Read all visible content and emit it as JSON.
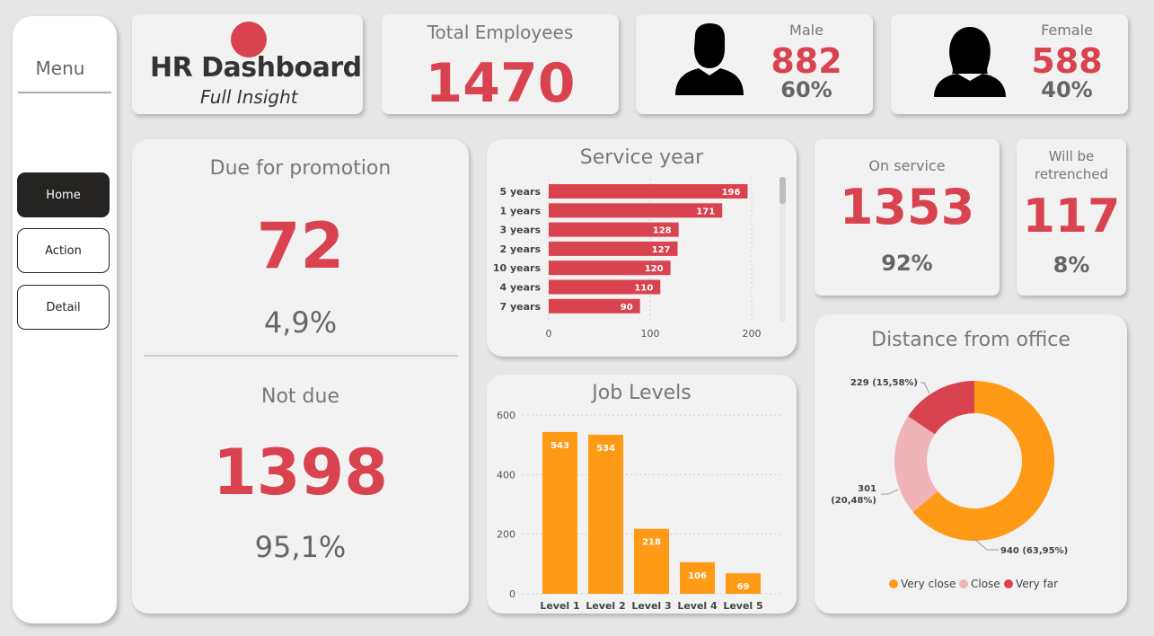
{
  "sidebar": {
    "title": "Menu",
    "buttons": [
      {
        "label": "Home",
        "active": true
      },
      {
        "label": "Action",
        "active": false
      },
      {
        "label": "Detail",
        "active": false
      }
    ]
  },
  "logo": {
    "title": "HR Dashboard",
    "subtitle": "Full Insight"
  },
  "total_employees": {
    "label": "Total Employees",
    "value": "1470"
  },
  "male": {
    "label": "Male",
    "value": "882",
    "pct": "60%",
    "icon": "male-person-icon"
  },
  "female": {
    "label": "Female",
    "value": "588",
    "pct": "40%",
    "icon": "female-person-icon"
  },
  "promotion": {
    "due_label": "Due for promotion",
    "due_value": "72",
    "due_pct": "4,9%",
    "not_due_label": "Not due",
    "not_due_value": "1398",
    "not_due_pct": "95,1%"
  },
  "on_service": {
    "label": "On service",
    "value": "1353",
    "pct": "92%"
  },
  "retrenched": {
    "label_line1": "Will be",
    "label_line2": "retrenched",
    "value": "117",
    "pct": "8%"
  },
  "colors": {
    "accent_red": "#d9434f",
    "bar_orange": "#ff9a17",
    "close_pink": "#f0b3b8"
  },
  "chart_data": [
    {
      "type": "bar",
      "orientation": "horizontal",
      "title": "Service year",
      "categories": [
        "5 years",
        "1 years",
        "3 years",
        "2 years",
        "10 years",
        "4 years",
        "7 years"
      ],
      "values": [
        196,
        171,
        128,
        127,
        120,
        110,
        90
      ],
      "xticks": [
        "0",
        "100",
        "200"
      ],
      "xlim": [
        0,
        200
      ],
      "grid": true,
      "color": "#d9434f"
    },
    {
      "type": "bar",
      "title": "Job Levels",
      "categories": [
        "Level 1",
        "Level 2",
        "Level 3",
        "Level 4",
        "Level 5"
      ],
      "values": [
        543,
        534,
        218,
        106,
        69
      ],
      "yticks": [
        "0",
        "200",
        "400",
        "600"
      ],
      "ylim": [
        0,
        600
      ],
      "grid": true,
      "color": "#ff9a17"
    },
    {
      "type": "pie",
      "donut": true,
      "title": "Distance from office",
      "slices": [
        {
          "name": "Very close",
          "value": 940,
          "label": "940 (63,95%)",
          "color": "#ff9a17"
        },
        {
          "name": "Close",
          "value": 301,
          "label_line1": "301",
          "label_line2": "(20,48%)",
          "color": "#f0b3b8"
        },
        {
          "name": "Very far",
          "value": 229,
          "label": "229 (15,58%)",
          "color": "#d9434f"
        }
      ],
      "legend": [
        "Very close",
        "Close",
        "Very far"
      ],
      "legend_position": "bottom"
    }
  ]
}
